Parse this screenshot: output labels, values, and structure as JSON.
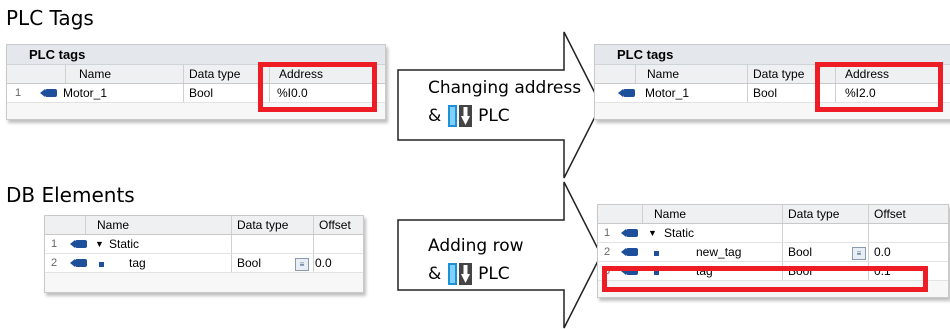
{
  "headings": {
    "plc_tags": "PLC Tags",
    "db_elements": "DB Elements"
  },
  "plc_before": {
    "title": "PLC tags",
    "columns": [
      "Name",
      "Data type",
      "Address"
    ],
    "row_number": "1",
    "name": "Motor_1",
    "data_type": "Bool",
    "address": "%I0.0"
  },
  "plc_after": {
    "title": "PLC tags",
    "columns": [
      "Name",
      "Data type",
      "Address"
    ],
    "row_number": "1",
    "name": "Motor_1",
    "data_type": "Bool",
    "address": "%I2.0"
  },
  "arrow_top": {
    "line1": "Changing address",
    "line2_prefix": "&",
    "line2_suffix": "PLC"
  },
  "arrow_bottom": {
    "line1": "Adding row",
    "line2_prefix": "&",
    "line2_suffix": "PLC"
  },
  "db_before": {
    "columns": [
      "Name",
      "Data type",
      "Offset"
    ],
    "rows": [
      {
        "num": "1",
        "name": "Static",
        "type": "",
        "offset": ""
      },
      {
        "num": "2",
        "name": "tag",
        "type": "Bool",
        "offset": "0.0"
      }
    ]
  },
  "db_after": {
    "columns": [
      "Name",
      "Data type",
      "Offset"
    ],
    "rows": [
      {
        "num": "1",
        "name": "Static",
        "type": "",
        "offset": ""
      },
      {
        "num": "2",
        "name": "new_tag",
        "type": "Bool",
        "offset": "0.0"
      },
      {
        "num": "3",
        "name": "tag",
        "type": "Bool",
        "offset": "0.1"
      }
    ]
  },
  "colors": {
    "highlight": "#ee1c25",
    "tag_icon": "#1e4f9a"
  },
  "icons": {
    "plc": "download-to-plc-icon",
    "tag": "tag-icon"
  }
}
